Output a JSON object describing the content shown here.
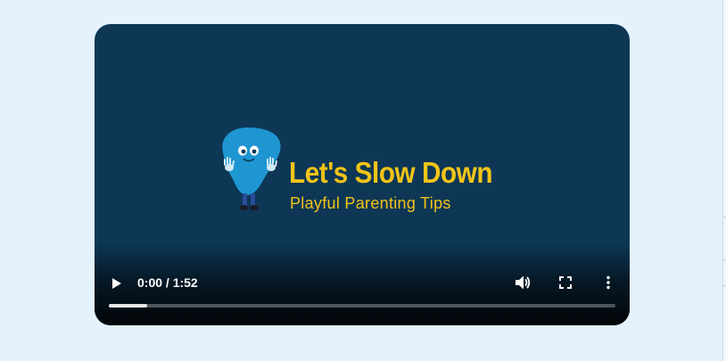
{
  "video": {
    "logo_title": "Let's Slow Down",
    "logo_subtitle": "Playful Parenting Tips",
    "time_display": "0:00 / 1:52",
    "buffered_fraction": 0.075
  },
  "controls": {
    "play_icon": "play-icon",
    "volume_icon": "volume-icon",
    "fullscreen_icon": "fullscreen-icon",
    "more_icon": "more-vert-icon"
  },
  "colors": {
    "page_background": "#e3f2fd",
    "video_background": "#0d3755",
    "brand_yellow": "#f2c418",
    "mascot_blue": "#1e96d2"
  }
}
